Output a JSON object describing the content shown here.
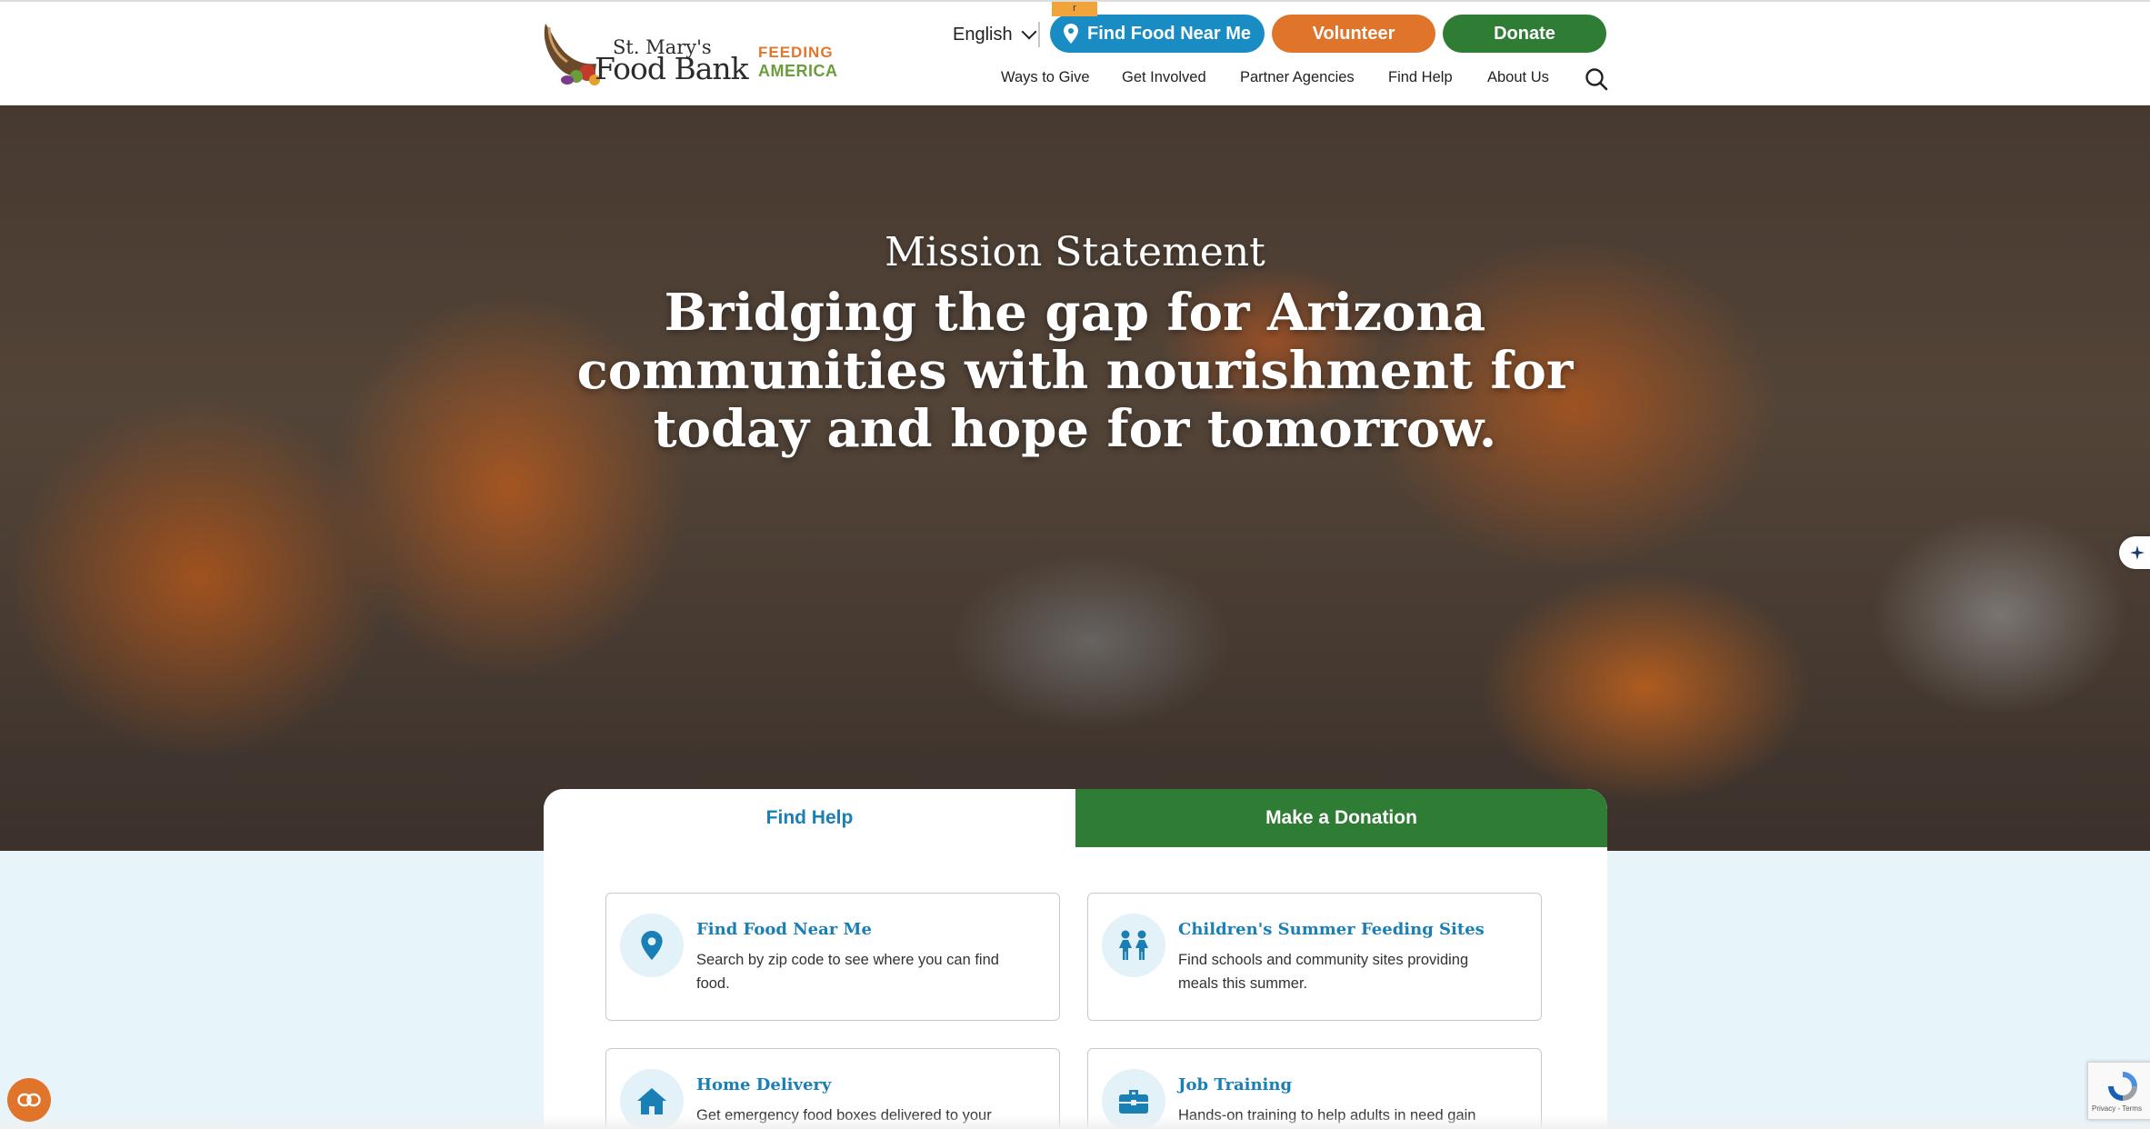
{
  "header": {
    "logo_line1": "St. Mary's",
    "logo_line2": "Food Bank",
    "partner_line1": "FEEDING",
    "partner_line2": "AMERICA",
    "language": "English",
    "buttons": {
      "find_food": "Find Food Near Me",
      "volunteer": "Volunteer",
      "donate": "Donate"
    },
    "tag_marker": "r",
    "nav": [
      "Ways to Give",
      "Get Involved",
      "Partner Agencies",
      "Find Help",
      "About Us"
    ]
  },
  "hero": {
    "eyebrow": "Mission Statement",
    "title": "Bridging the gap for Arizona communities with nourishment for today and hope for tomorrow."
  },
  "tabs": {
    "find_help": "Find Help",
    "make_donation": "Make a Donation"
  },
  "cards": [
    {
      "title": "Find Food Near Me",
      "desc": "Search by zip code to see where you can find food.",
      "icon": "map-pin-icon"
    },
    {
      "title": "Children's Summer Feeding Sites",
      "desc": "Find schools and community sites providing meals this summer.",
      "icon": "children-icon"
    },
    {
      "title": "Home Delivery",
      "desc": "Get emergency food boxes delivered to your",
      "icon": "house-icon"
    },
    {
      "title": "Job Training",
      "desc": "Hands-on training to help adults in need gain",
      "icon": "briefcase-icon"
    }
  ],
  "recaptcha": {
    "links": "Privacy - Terms"
  },
  "colors": {
    "blue": "#1a8cc4",
    "orange": "#e0742a",
    "green": "#2f7d34",
    "card_title": "#1a7fb5",
    "light_bg": "#e7f4fa"
  }
}
